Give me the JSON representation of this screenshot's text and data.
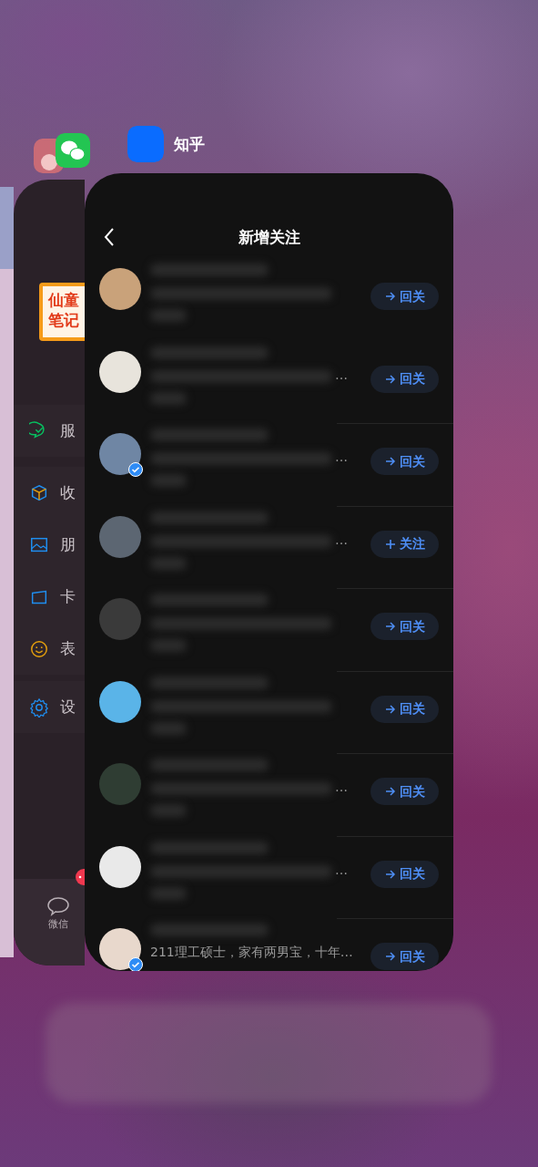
{
  "switcher": {
    "front_app_label": "知乎"
  },
  "wechat_card": {
    "sticker_lines": [
      "仙童",
      "笔记"
    ],
    "sections": [
      {
        "items": [
          {
            "kind": "service",
            "label": "服"
          }
        ]
      },
      {
        "items": [
          {
            "kind": "favorites",
            "label": "收"
          },
          {
            "kind": "moments",
            "label": "朋"
          },
          {
            "kind": "cards",
            "label": "卡"
          },
          {
            "kind": "stickers",
            "label": "表"
          }
        ]
      },
      {
        "items": [
          {
            "kind": "settings",
            "label": "设"
          }
        ]
      }
    ],
    "tab_bar": [
      {
        "label": "微信",
        "badge": true
      }
    ]
  },
  "zhihu_card": {
    "title": "新增关注",
    "rows": [
      {
        "bio_blurred": true,
        "verified": false,
        "action": {
          "kind": "follow_back",
          "label": "回关"
        }
      },
      {
        "bio_blurred": true,
        "bio": "…",
        "verified": false,
        "action": {
          "kind": "follow_back",
          "label": "回关"
        }
      },
      {
        "bio_blurred": true,
        "bio": "…",
        "verified": true,
        "action": {
          "kind": "follow_back",
          "label": "回关"
        }
      },
      {
        "bio_blurred": true,
        "bio": "…",
        "verified": false,
        "action": {
          "kind": "follow",
          "label": "关注"
        }
      },
      {
        "bio_blurred": true,
        "verified": false,
        "action": {
          "kind": "follow_back",
          "label": "回关"
        }
      },
      {
        "bio_blurred": true,
        "verified": false,
        "action": {
          "kind": "follow_back",
          "label": "回关"
        }
      },
      {
        "bio_blurred": true,
        "bio": "…",
        "verified": false,
        "action": {
          "kind": "follow_back",
          "label": "回关"
        }
      },
      {
        "bio_blurred": true,
        "bio": "…",
        "verified": false,
        "action": {
          "kind": "follow_back",
          "label": "回关"
        }
      },
      {
        "bio_blurred": false,
        "bio": "211理工硕士，家有两男宝，十年…",
        "verified": true,
        "action": {
          "kind": "follow_back",
          "label": "回关"
        }
      }
    ]
  }
}
